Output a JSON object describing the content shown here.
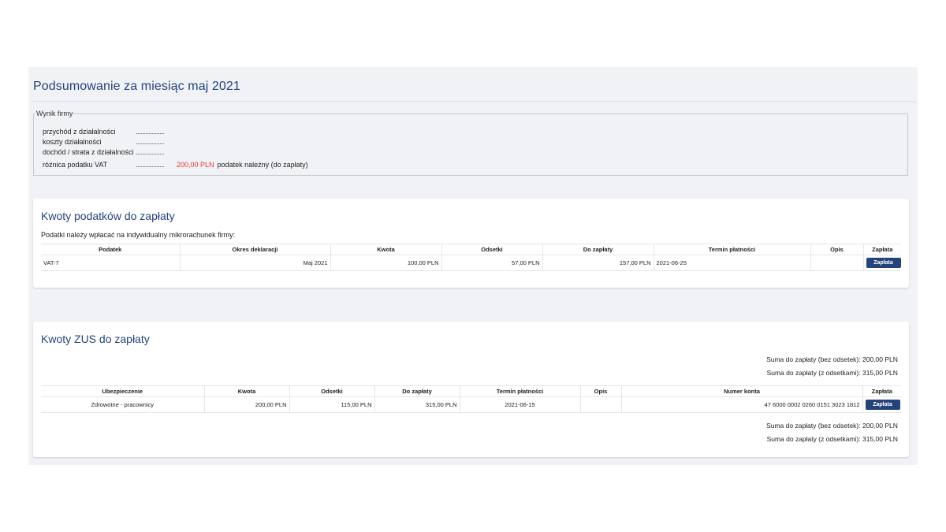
{
  "summary": {
    "title": "Podsumowanie za miesiąc maj 2021",
    "firm_result": {
      "legend": "Wynik firmy",
      "rows": [
        {
          "label": "przychód z działalności",
          "dots": "..................",
          "value": "",
          "note": ""
        },
        {
          "label": "koszty działalności",
          "dots": "..................",
          "value": "",
          "note": ""
        },
        {
          "label": "dochód / strata z działalności",
          "dots": "..................",
          "value": "",
          "note": ""
        },
        {
          "label": "różnica podatku VAT",
          "dots": "..................",
          "value": "200,00 PLN",
          "note": "podatek należny (do zapłaty)"
        }
      ]
    }
  },
  "taxes": {
    "title": "Kwoty podatków do zapłaty",
    "note": "Podatki należy wpłacać na indywidualny mikrorachunek firmy:",
    "headers": [
      "Podatek",
      "Okres deklaracji",
      "Kwota",
      "Odsetki",
      "Do zapłaty",
      "Termin płatności",
      "Opis",
      "Zapłata"
    ],
    "rows": [
      {
        "podatek": "VAT-7",
        "okres": "Maj 2021",
        "kwota": "100,00 PLN",
        "odsetki": "57,00 PLN",
        "do_zaplaty": "157,00 PLN",
        "termin": "2021-06-25",
        "opis": "",
        "button": "Zapłata"
      }
    ]
  },
  "zus": {
    "title": "Kwoty ZUS do zapłaty",
    "sum_top": [
      {
        "label": "Suma do zapłaty (bez odsetek):",
        "value": "200,00 PLN"
      },
      {
        "label": "Suma do zapłaty (z odsetkami):",
        "value": "315,00 PLN"
      }
    ],
    "headers": [
      "Ubezpieczenie",
      "Kwota",
      "Odsetki",
      "Do zapłaty",
      "Termin płatności",
      "Opis",
      "Numer konta",
      "Zapłata"
    ],
    "rows": [
      {
        "ubezpieczenie": "Zdrowotne - pracownicy",
        "kwota": "200,00 PLN",
        "odsetki": "115,00 PLN",
        "do_zaplaty": "315,00 PLN",
        "termin": "2021-06-15",
        "opis": "",
        "konto": "47 6000 0002 0260 0151 3023 1812",
        "button": "Zapłata"
      }
    ],
    "sum_bottom": [
      {
        "label": "Suma do zapłaty (bez odsetek):",
        "value": "200,00 PLN"
      },
      {
        "label": "Suma do zapłaty (z odsetkami):",
        "value": "315,00 PLN"
      }
    ]
  },
  "colors": {
    "accent": "#24437a",
    "alert": "#e53935",
    "panel_bg": "#f1f2f5"
  }
}
